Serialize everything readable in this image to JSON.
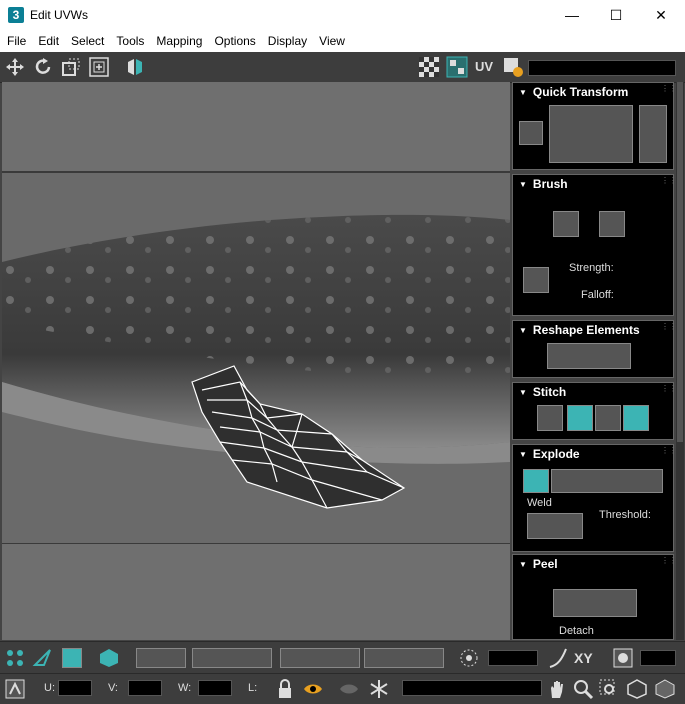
{
  "window": {
    "title": "Edit UVWs",
    "app_icon": "3",
    "minimize": "—",
    "maximize": "☐",
    "close": "✕"
  },
  "menu": [
    "File",
    "Edit",
    "Select",
    "Tools",
    "Mapping",
    "Options",
    "Display",
    "View"
  ],
  "toolbar": {
    "uv_label": "UV"
  },
  "rollouts": {
    "quick_transform": {
      "title": "Quick Transform"
    },
    "brush": {
      "title": "Brush",
      "strength": "Strength:",
      "falloff": "Falloff:"
    },
    "reshape": {
      "title": "Reshape Elements"
    },
    "stitch": {
      "title": "Stitch"
    },
    "explode": {
      "title": "Explode",
      "weld": "Weld",
      "threshold": "Threshold:"
    },
    "peel": {
      "title": "Peel",
      "detach": "Detach"
    }
  },
  "bottom": {
    "xy_label": "XY",
    "u_label": "U:",
    "v_label": "V:",
    "w_label": "W:",
    "l_label": "L:"
  },
  "colors": {
    "accent": "#3cb4b4",
    "panel_bg": "#000000",
    "toolbar_bg": "#3d3d3d"
  }
}
